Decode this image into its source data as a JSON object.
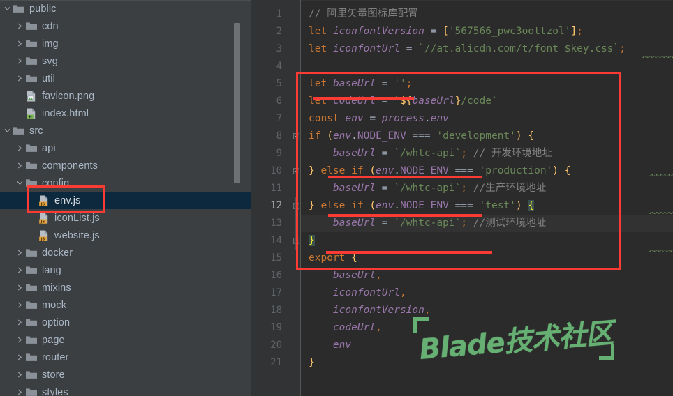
{
  "sidebar": {
    "scrollbar": "vertical-scrollbar",
    "items": [
      {
        "label": "public",
        "type": "folder",
        "indent": 0,
        "arrow": "down",
        "selected": false
      },
      {
        "label": "cdn",
        "type": "folder",
        "indent": 1,
        "arrow": "right",
        "selected": false
      },
      {
        "label": "img",
        "type": "folder",
        "indent": 1,
        "arrow": "right",
        "selected": false
      },
      {
        "label": "svg",
        "type": "folder",
        "indent": 1,
        "arrow": "right",
        "selected": false
      },
      {
        "label": "util",
        "type": "folder",
        "indent": 1,
        "arrow": "right",
        "selected": false
      },
      {
        "label": "favicon.png",
        "type": "png",
        "indent": 1,
        "arrow": "none",
        "selected": false
      },
      {
        "label": "index.html",
        "type": "html",
        "indent": 1,
        "arrow": "none",
        "selected": false
      },
      {
        "label": "src",
        "type": "folder",
        "indent": 0,
        "arrow": "down",
        "selected": false
      },
      {
        "label": "api",
        "type": "folder",
        "indent": 1,
        "arrow": "right",
        "selected": false
      },
      {
        "label": "components",
        "type": "folder",
        "indent": 1,
        "arrow": "right",
        "selected": false
      },
      {
        "label": "config",
        "type": "folder",
        "indent": 1,
        "arrow": "down",
        "selected": false
      },
      {
        "label": "env.js",
        "type": "js",
        "indent": 2,
        "arrow": "none",
        "selected": true
      },
      {
        "label": "iconList.js",
        "type": "js",
        "indent": 2,
        "arrow": "none",
        "selected": false
      },
      {
        "label": "website.js",
        "type": "js",
        "indent": 2,
        "arrow": "none",
        "selected": false
      },
      {
        "label": "docker",
        "type": "folder",
        "indent": 1,
        "arrow": "right",
        "selected": false
      },
      {
        "label": "lang",
        "type": "folder",
        "indent": 1,
        "arrow": "right",
        "selected": false
      },
      {
        "label": "mixins",
        "type": "folder",
        "indent": 1,
        "arrow": "right",
        "selected": false
      },
      {
        "label": "mock",
        "type": "folder",
        "indent": 1,
        "arrow": "right",
        "selected": false
      },
      {
        "label": "option",
        "type": "folder",
        "indent": 1,
        "arrow": "right",
        "selected": false
      },
      {
        "label": "page",
        "type": "folder",
        "indent": 1,
        "arrow": "right",
        "selected": false
      },
      {
        "label": "router",
        "type": "folder",
        "indent": 1,
        "arrow": "right",
        "selected": false
      },
      {
        "label": "store",
        "type": "folder",
        "indent": 1,
        "arrow": "right",
        "selected": false
      },
      {
        "label": "styles",
        "type": "folder",
        "indent": 1,
        "arrow": "right",
        "selected": false
      }
    ]
  },
  "editor": {
    "file": "env.js",
    "current_line": 12,
    "line_numbers": [
      "1",
      "2",
      "3",
      "4",
      "5",
      "6",
      "7",
      "8",
      "9",
      "10",
      "11",
      "12",
      "13",
      "14",
      "15",
      "16",
      "17",
      "18",
      "19",
      "20",
      "21"
    ],
    "lines": [
      {
        "n": 1,
        "text": "// 阿里矢量图标库配置"
      },
      {
        "n": 2,
        "text": "let iconfontVersion = ['567566_pwc3oottzol'];"
      },
      {
        "n": 3,
        "text": "let iconfontUrl = `//at.alicdn.com/t/font_$key.css`;"
      },
      {
        "n": 4,
        "text": ""
      },
      {
        "n": 5,
        "text": "let baseUrl = '';"
      },
      {
        "n": 6,
        "text": "let codeUrl = `${baseUrl}/code`"
      },
      {
        "n": 7,
        "text": "const env = process.env"
      },
      {
        "n": 8,
        "text": "if (env.NODE_ENV === 'development') {"
      },
      {
        "n": 9,
        "text": "    baseUrl = `/whtc-api`; // 开发环境地址"
      },
      {
        "n": 10,
        "text": "} else if (env.NODE_ENV === 'production') {"
      },
      {
        "n": 11,
        "text": "    baseUrl = `/whtc-api`; //生产环境地址"
      },
      {
        "n": 12,
        "text": "} else if (env.NODE_ENV === 'test') {"
      },
      {
        "n": 13,
        "text": "    baseUrl = `/whtc-api`; //测试环境地址"
      },
      {
        "n": 14,
        "text": "}"
      },
      {
        "n": 15,
        "text": "export {"
      },
      {
        "n": 16,
        "text": "    baseUrl,"
      },
      {
        "n": 17,
        "text": "    iconfontUrl,"
      },
      {
        "n": 18,
        "text": "    iconfontVersion,"
      },
      {
        "n": 19,
        "text": "    codeUrl,"
      },
      {
        "n": 20,
        "text": "    env"
      },
      {
        "n": 21,
        "text": "}"
      }
    ]
  },
  "annotations": {
    "box_label": "red-highlight-box",
    "underline_label": "red-underline",
    "selection_box_label": "red-file-highlight-box",
    "color": "#fd3b35"
  },
  "watermark": {
    "text": "Blade技术社区",
    "color": "#67b073"
  },
  "theme": {
    "sidebar_bg": "#3c3f41",
    "editor_bg": "#2b2b2b",
    "gutter_bg": "#313335",
    "selection_bg": "#0d293e",
    "keyword": "#cc7832",
    "string": "#6a8759",
    "variable": "#9876aa",
    "comment": "#808080",
    "text": "#a9b7c6"
  }
}
